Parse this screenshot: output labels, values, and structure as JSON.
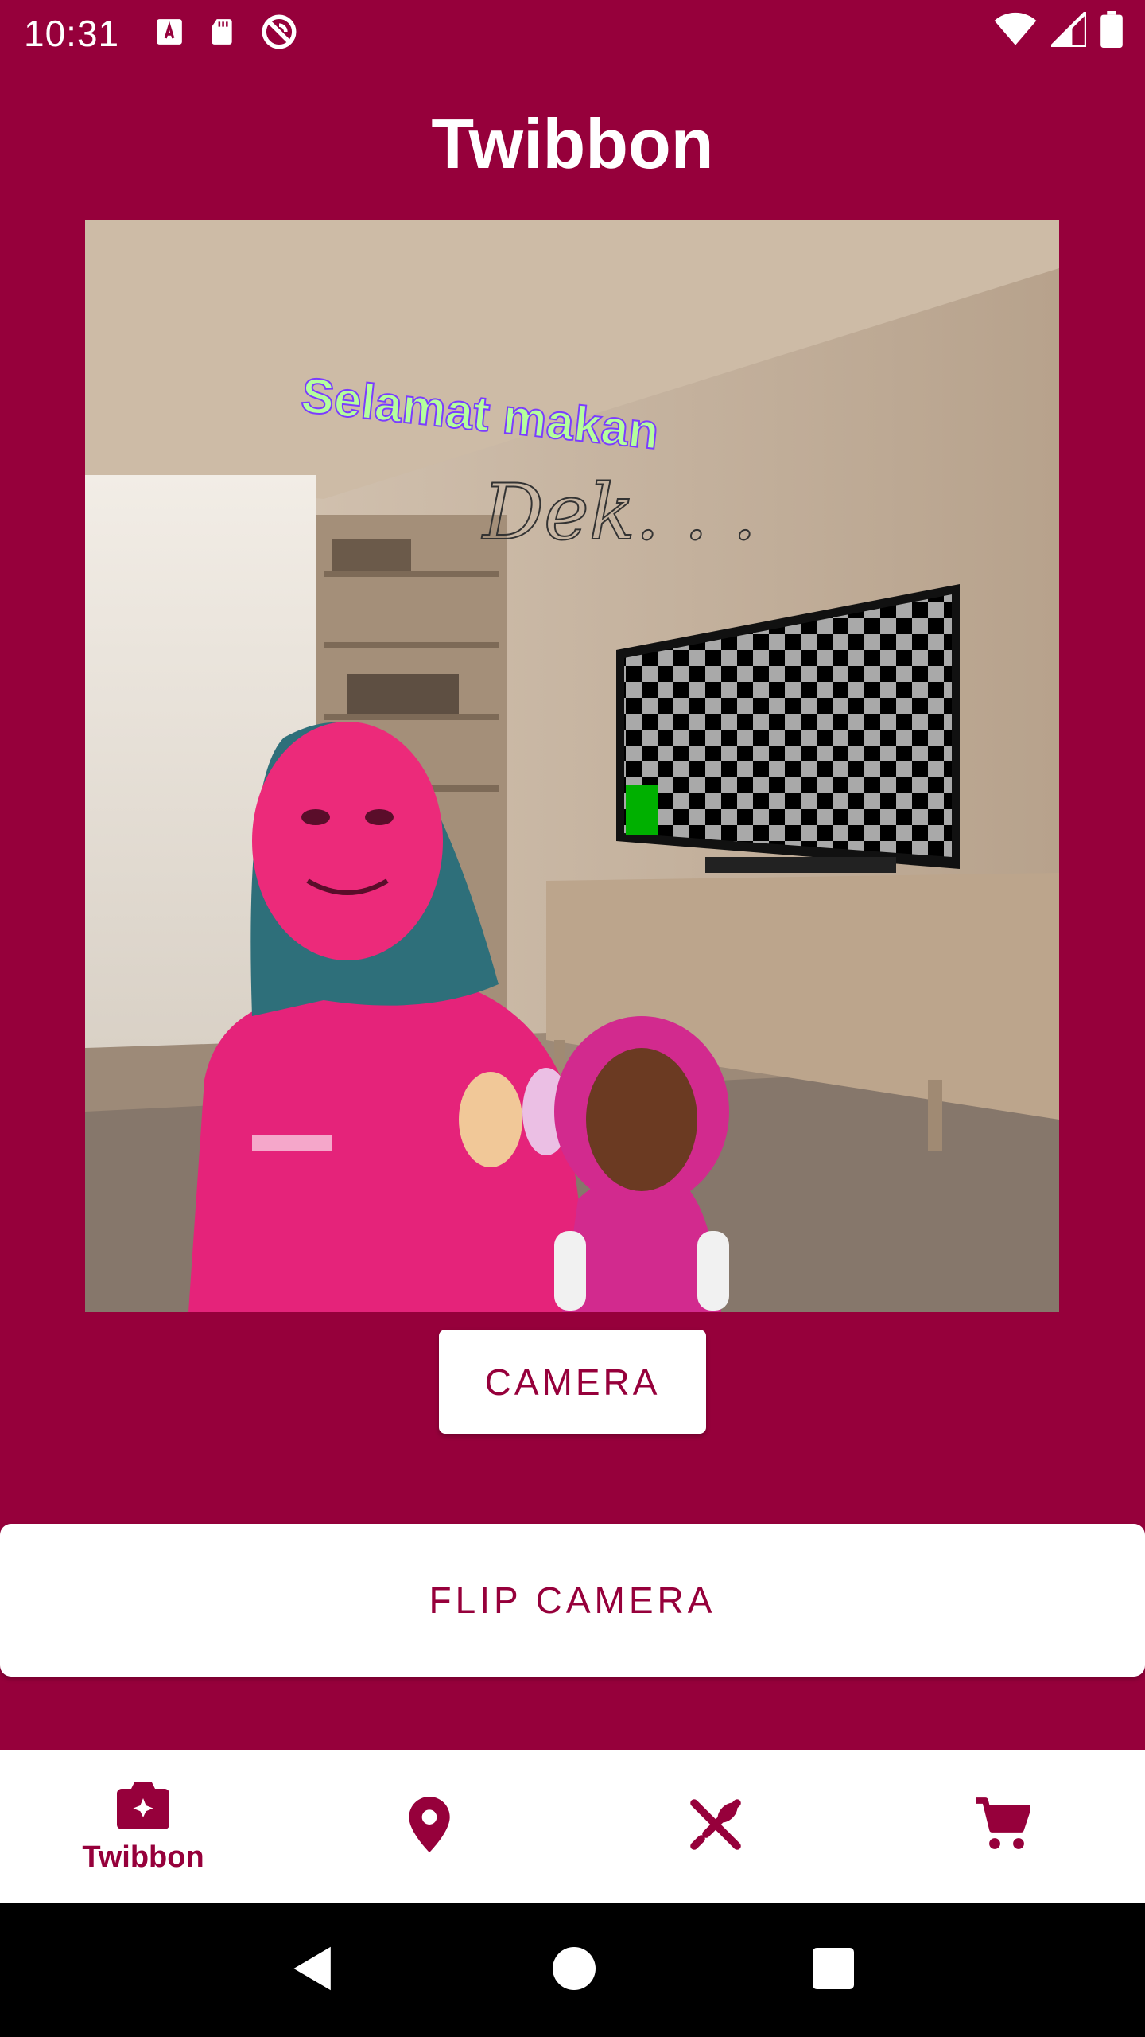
{
  "status_bar": {
    "time": "10:31",
    "left_icons": [
      "font-download-icon",
      "sd-card-icon",
      "sync-disabled-icon"
    ],
    "right_icons": [
      "wifi-icon",
      "cell-signal-icon",
      "battery-icon"
    ]
  },
  "header": {
    "title": "Twibbon"
  },
  "twibbon": {
    "overlay_text_1": "Selamat makan",
    "overlay_text_2": "Dek. . ."
  },
  "actions": {
    "camera_label": "CAMERA",
    "flip_label": "FLIP CAMERA"
  },
  "bottom_nav": {
    "items": [
      {
        "icon": "camera-icon",
        "label": "Twibbon",
        "active": true
      },
      {
        "icon": "location-pin-icon",
        "label": ""
      },
      {
        "icon": "restaurant-icon",
        "label": ""
      },
      {
        "icon": "cart-icon",
        "label": ""
      }
    ]
  },
  "system_nav": [
    "back-icon",
    "home-icon",
    "recents-icon"
  ],
  "colors": {
    "primary": "#96003b",
    "surface": "#ffffff"
  }
}
